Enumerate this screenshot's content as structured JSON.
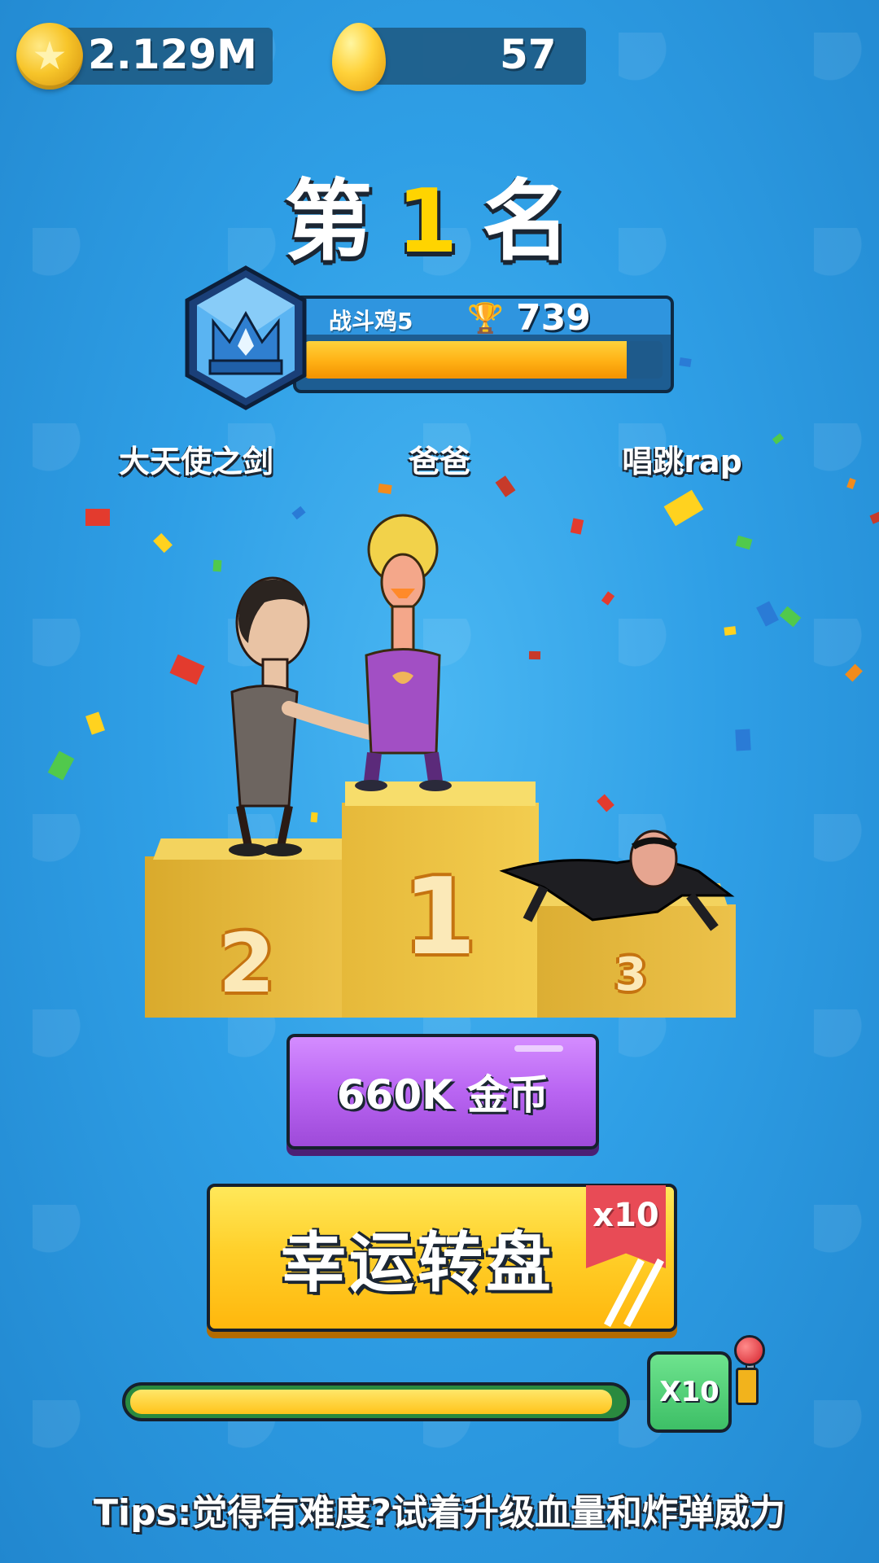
{
  "hud": {
    "coins": "2.129M",
    "eggs": "57"
  },
  "result": {
    "rank_prefix": "第",
    "rank_number": "1",
    "rank_suffix": "名"
  },
  "level": {
    "name": "战斗鸡5",
    "trophies": "739",
    "progress": 0.9
  },
  "players": {
    "second": "大天使之剑",
    "first": "爸爸",
    "third": "唱跳rap"
  },
  "podium": {
    "first": "1",
    "second": "2",
    "third": "3"
  },
  "reward": {
    "label": "660K  金币"
  },
  "lucky_wheel": {
    "label": "幸运转盘",
    "multiplier": "x10"
  },
  "multiplier_bar": {
    "label": "X10",
    "progress": 0.98
  },
  "tips": "Tips:觉得有难度?试着升级血量和炸弹威力",
  "colors": {
    "background": "#2f9fe6",
    "coin_button": "#b965f2",
    "lucky_button": "#ffd02a",
    "ribbon": "#e84b56",
    "accent_yellow": "#ffd400"
  }
}
